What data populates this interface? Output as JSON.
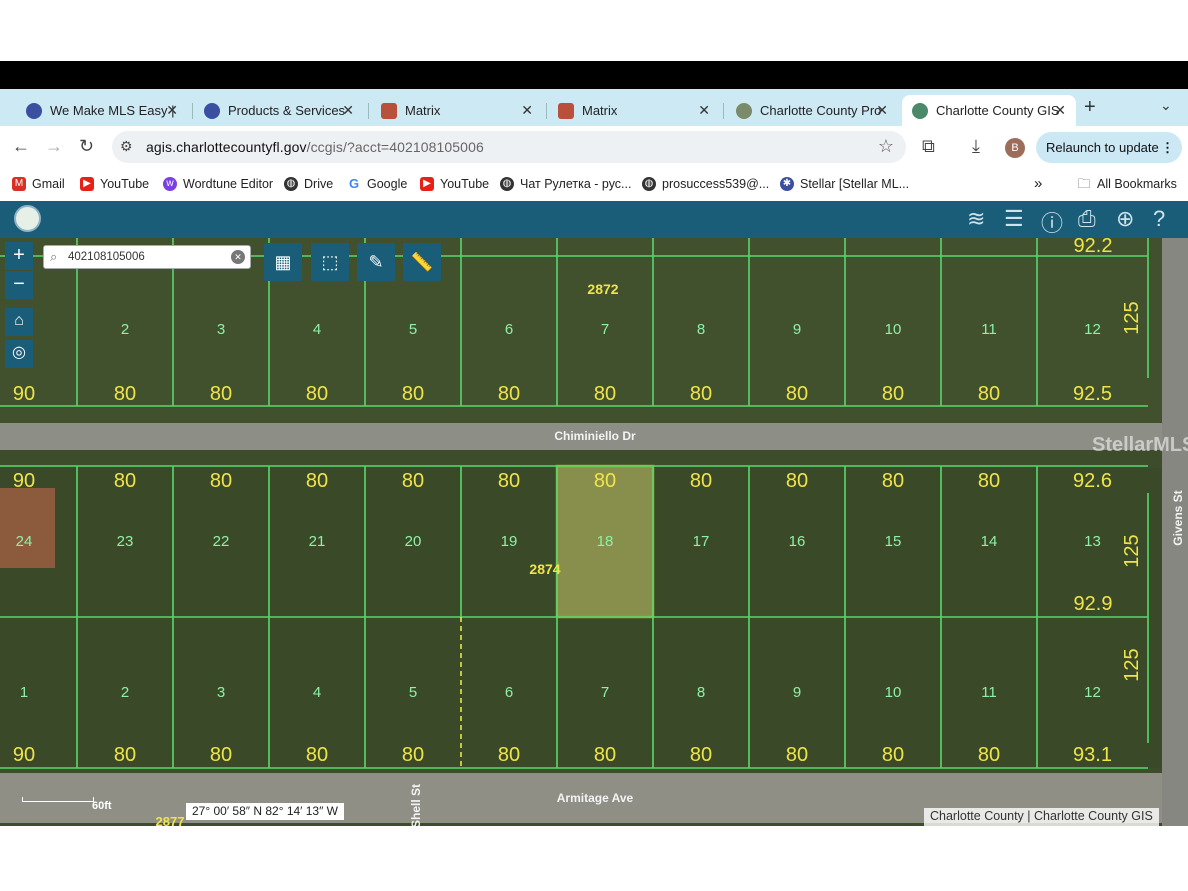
{
  "tabs": [
    {
      "label": "We Make MLS Easy |",
      "favicon": "stellar-icon",
      "color": "#3a4fa0",
      "active": false
    },
    {
      "label": "Products & Services",
      "favicon": "stellar-icon",
      "color": "#3a4fa0",
      "active": false
    },
    {
      "label": "Matrix",
      "favicon": "matrix-icon",
      "color": "#b8503a",
      "active": false
    },
    {
      "label": "Matrix",
      "favicon": "matrix-icon",
      "color": "#b8503a",
      "active": false
    },
    {
      "label": "Charlotte County Pro",
      "favicon": "county-seal-icon",
      "color": "#7a8a6a",
      "active": false
    },
    {
      "label": "Charlotte County GIS",
      "favicon": "county-seal-icon",
      "color": "#4a8a6a",
      "active": true
    }
  ],
  "toolbar": {
    "url_host": "agis.charlottecountyfl.gov",
    "url_path": "/ccgis/?acct=402108105006",
    "profile_initial": "B",
    "relaunch_label": "Relaunch to update"
  },
  "bookmarks": [
    {
      "label": "Gmail",
      "icon": "gmail-icon",
      "color": "#d93025"
    },
    {
      "label": "YouTube",
      "icon": "youtube-icon",
      "color": "#e62117"
    },
    {
      "label": "Wordtune Editor",
      "icon": "wordtune-icon",
      "color": "#7b3fe4"
    },
    {
      "label": "Drive",
      "icon": "globe-icon",
      "color": "#333333"
    },
    {
      "label": "Google",
      "icon": "google-icon",
      "color": "#4285f4"
    },
    {
      "label": "YouTube",
      "icon": "youtube-icon",
      "color": "#e62117"
    },
    {
      "label": "Чат Рулетка - рус...",
      "icon": "globe-icon",
      "color": "#333333"
    },
    {
      "label": "prosuccess539@...",
      "icon": "globe-icon",
      "color": "#333333"
    },
    {
      "label": "Stellar [Stellar ML...",
      "icon": "stellar-icon",
      "color": "#3a4fa0"
    }
  ],
  "bookmarks_overflow": "»",
  "all_bookmarks_label": "All Bookmarks",
  "map": {
    "search_value": "402108105006",
    "streets": [
      "Chiminiello Dr",
      "Armitage Ave",
      "Givens St",
      "Shell St"
    ],
    "block_numbers": [
      "2872",
      "2874",
      "2877"
    ],
    "selected_lot": "18",
    "top_row_lots": [
      "2",
      "3",
      "4",
      "5",
      "6",
      "7",
      "8",
      "9",
      "10",
      "11",
      "12"
    ],
    "top_row_widths": [
      "90",
      "80",
      "80",
      "80",
      "80",
      "80",
      "80",
      "80",
      "80",
      "80",
      "80",
      "92.5"
    ],
    "top_corner": "92.2",
    "top_depth": "125",
    "mid_row_widths": [
      "90",
      "80",
      "80",
      "80",
      "80",
      "80",
      "80",
      "80",
      "80",
      "80",
      "80",
      "92.6"
    ],
    "mid_row_lots": [
      "24",
      "23",
      "22",
      "21",
      "20",
      "19",
      "18",
      "17",
      "16",
      "15",
      "14",
      "13"
    ],
    "mid_lower_corner": "92.9",
    "mid_depth": "125",
    "bottom_row_lots": [
      "1",
      "2",
      "3",
      "4",
      "5",
      "6",
      "7",
      "8",
      "9",
      "10",
      "11",
      "12"
    ],
    "bottom_row_widths": [
      "90",
      "80",
      "80",
      "80",
      "80",
      "80",
      "80",
      "80",
      "80",
      "80",
      "80",
      "93.1"
    ],
    "bottom_depth": "125",
    "coordinates": "27° 00′ 58″ N 82° 14′ 13″ W",
    "scale_label": "60ft",
    "attribution": "Charlotte County | Charlotte County GIS",
    "watermark": "StellarMLS"
  }
}
